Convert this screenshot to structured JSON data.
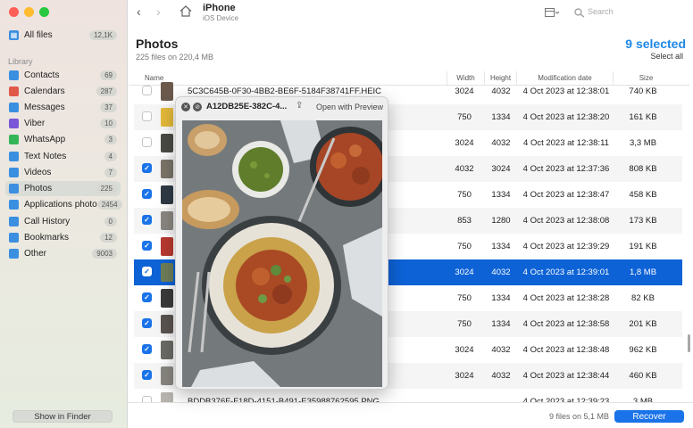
{
  "window": {
    "title": "iPhone",
    "subtitle": "iOS Device",
    "search_placeholder": "Search"
  },
  "sidebar": {
    "all_files": {
      "label": "All files",
      "count": "12,1K"
    },
    "section_label": "Library",
    "items": [
      {
        "label": "Contacts",
        "count": "69",
        "color": "#3b8fe0"
      },
      {
        "label": "Calendars",
        "count": "287",
        "color": "#e05a4a"
      },
      {
        "label": "Messages",
        "count": "37",
        "color": "#3b8fe0"
      },
      {
        "label": "Viber",
        "count": "10",
        "color": "#7b57d8"
      },
      {
        "label": "WhatsApp",
        "count": "3",
        "color": "#34b556"
      },
      {
        "label": "Text Notes",
        "count": "4",
        "color": "#3b8fe0"
      },
      {
        "label": "Videos",
        "count": "7",
        "color": "#3b8fe0"
      },
      {
        "label": "Photos",
        "count": "225",
        "color": "#3b8fe0"
      },
      {
        "label": "Applications photo",
        "count": "2454",
        "color": "#3b8fe0"
      },
      {
        "label": "Call History",
        "count": "0",
        "color": "#3b8fe0"
      },
      {
        "label": "Bookmarks",
        "count": "12",
        "color": "#3b8fe0"
      },
      {
        "label": "Other",
        "count": "9003",
        "color": "#3b8fe0"
      }
    ],
    "show_in_finder": "Show in Finder"
  },
  "header": {
    "title": "Photos",
    "subtitle": "225 files on 220,4 MB",
    "selected": "9 selected",
    "select_all": "Select all"
  },
  "table": {
    "columns": [
      "Name",
      "Width",
      "Height",
      "Modification date",
      "Size"
    ],
    "rows": [
      {
        "name": "5C3C645B-0F30-4BB2-BE6F-5184F38741FF.HEIC",
        "width": "3024",
        "height": "4032",
        "date": "4 Oct 2023 at 12:38:01",
        "size": "740 KB",
        "checked": false,
        "thumb": "#6b5a4c"
      },
      {
        "name": "",
        "width": "750",
        "height": "1334",
        "date": "4 Oct 2023 at 12:38:20",
        "size": "161 KB",
        "checked": false,
        "thumb": "#e3b93a"
      },
      {
        "name": "",
        "width": "3024",
        "height": "4032",
        "date": "4 Oct 2023 at 12:38:11",
        "size": "3,3 MB",
        "checked": false,
        "thumb": "#4b4b46"
      },
      {
        "name": "",
        "width": "4032",
        "height": "3024",
        "date": "4 Oct 2023 at 12:37:36",
        "size": "808 KB",
        "checked": true,
        "thumb": "#7a7468"
      },
      {
        "name": "",
        "width": "750",
        "height": "1334",
        "date": "4 Oct 2023 at 12:38:47",
        "size": "458 KB",
        "checked": true,
        "thumb": "#2f3a45"
      },
      {
        "name": "",
        "width": "853",
        "height": "1280",
        "date": "4 Oct 2023 at 12:38:08",
        "size": "173 KB",
        "checked": true,
        "thumb": "#8a8680"
      },
      {
        "name": "",
        "width": "750",
        "height": "1334",
        "date": "4 Oct 2023 at 12:39:29",
        "size": "191 KB",
        "checked": true,
        "thumb": "#b83a30"
      },
      {
        "name": "",
        "width": "3024",
        "height": "4032",
        "date": "4 Oct 2023 at 12:39:01",
        "size": "1,8 MB",
        "checked": true,
        "thumb": "#6f7d5a",
        "selected": true
      },
      {
        "name": "",
        "width": "750",
        "height": "1334",
        "date": "4 Oct 2023 at 12:38:28",
        "size": "82 KB",
        "checked": true,
        "thumb": "#3a3a3a"
      },
      {
        "name": "",
        "width": "750",
        "height": "1334",
        "date": "4 Oct 2023 at 12:38:58",
        "size": "201 KB",
        "checked": true,
        "thumb": "#5a5350"
      },
      {
        "name": "",
        "width": "3024",
        "height": "4032",
        "date": "4 Oct 2023 at 12:38:48",
        "size": "962 KB",
        "checked": true,
        "thumb": "#6a6a66"
      },
      {
        "name": "",
        "width": "3024",
        "height": "4032",
        "date": "4 Oct 2023 at 12:38:44",
        "size": "460 KB",
        "checked": true,
        "thumb": "#888580"
      },
      {
        "name": "BDDB376F-F18D-4151-B491-E35988762595.PNG",
        "width": "",
        "height": "",
        "date": "4 Oct 2023 at 12:39:23",
        "size": "3 MB",
        "checked": false,
        "thumb": "#b8b4ae"
      }
    ]
  },
  "footer": {
    "summary": "9 files on 5,1 MB",
    "recover": "Recover"
  },
  "preview": {
    "file_name": "A12DB25E-382C-4...",
    "open_with": "Open with Preview"
  },
  "colors": {
    "accent": "#1a73e8",
    "selected_row": "#0d62d6"
  }
}
